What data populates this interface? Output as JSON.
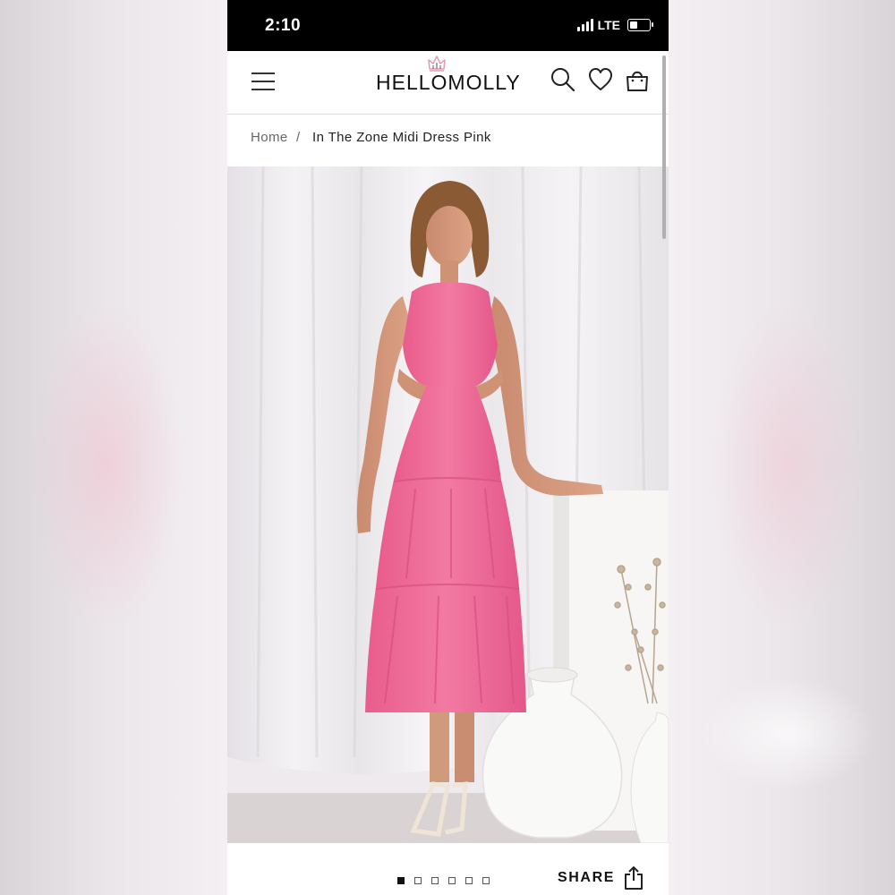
{
  "status_bar": {
    "time": "2:10",
    "network": "LTE",
    "icons": [
      "signal-icon",
      "battery-icon"
    ]
  },
  "header": {
    "brand": "HELLOMOLLY",
    "icons": [
      "menu-icon",
      "crown-icon",
      "search-icon",
      "heart-icon",
      "bag-icon"
    ]
  },
  "breadcrumb": {
    "home": "Home",
    "separator": "/",
    "current": "In The Zone Midi Dress Pink"
  },
  "gallery": {
    "image_count": 6,
    "active_index": 0,
    "share_label": "SHARE",
    "share_icon": "share-icon"
  },
  "colors": {
    "accent_pink": "#ef6f9a",
    "crown_pink": "#e59ab8",
    "status_bar": "#000000"
  }
}
